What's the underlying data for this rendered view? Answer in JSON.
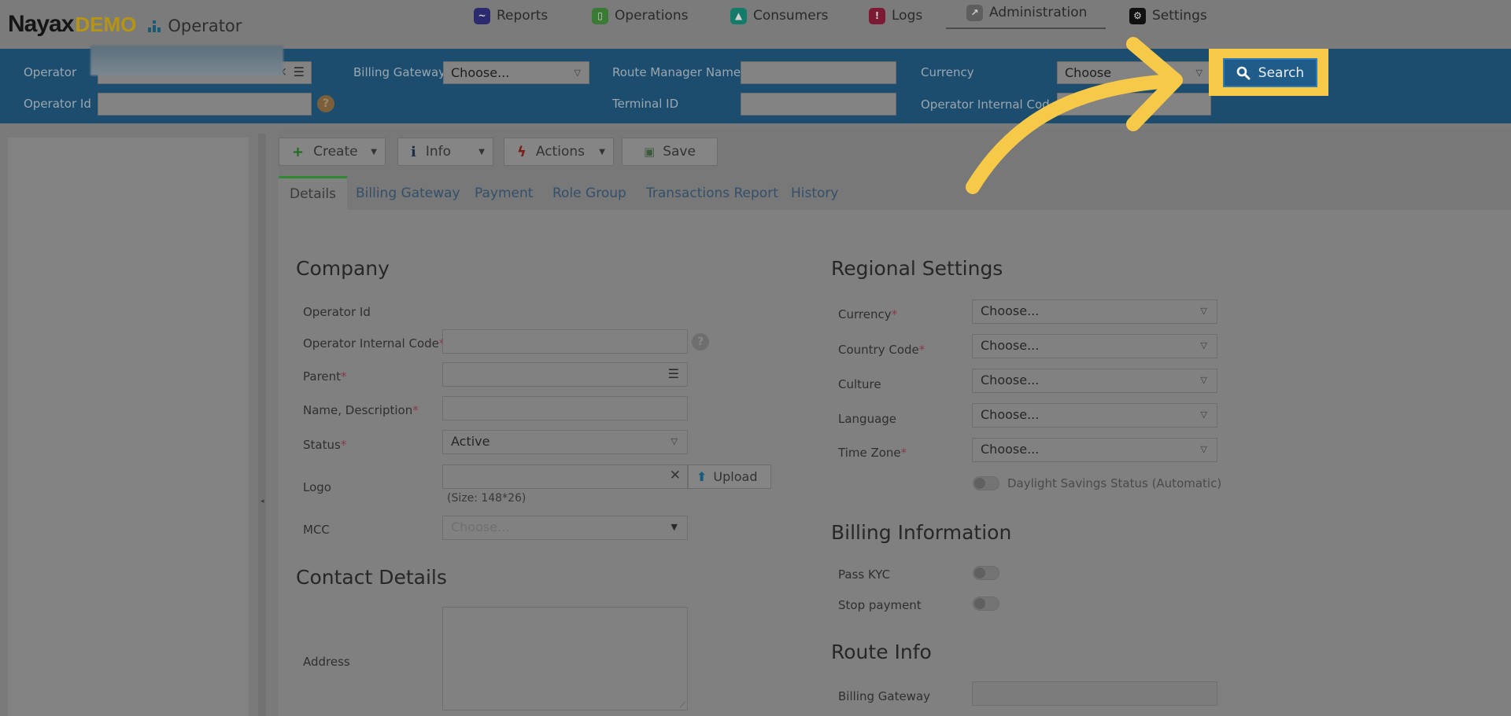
{
  "brand": {
    "name": "Nayax",
    "suffix": "DEMO",
    "section_label": "Operator"
  },
  "nav": [
    {
      "label": "Reports",
      "icon": "chart-line-icon",
      "color": "#2c2a6e"
    },
    {
      "label": "Operations",
      "icon": "clipboard-icon",
      "color": "#3a7a35"
    },
    {
      "label": "Consumers",
      "icon": "users-icon",
      "color": "#147a6a"
    },
    {
      "label": "Logs",
      "icon": "alert-icon",
      "color": "#7d1a33"
    },
    {
      "label": "Administration",
      "icon": "wrench-icon",
      "color": "#5e5e5e",
      "active": true
    },
    {
      "label": "Settings",
      "icon": "gear-icon",
      "color": "#111111"
    }
  ],
  "filters": {
    "operator_label": "Operator",
    "operator_id_label": "Operator Id",
    "billing_gateway_label": "Billing Gateway",
    "billing_gateway_value": "Choose...",
    "route_manager_label": "Route Manager Name",
    "terminal_id_label": "Terminal ID",
    "currency_label": "Currency",
    "currency_value": "Choose",
    "operator_internal_label": "Operator Internal Code",
    "search_label": "Search"
  },
  "toolbar": {
    "create": "Create",
    "info": "Info",
    "actions": "Actions",
    "save": "Save"
  },
  "tabs": [
    "Details",
    "Billing Gateway",
    "Payment",
    "Role Group",
    "Transactions Report",
    "History"
  ],
  "company": {
    "title": "Company",
    "operator_id": "Operator Id",
    "internal_code": "Operator Internal Code",
    "parent": "Parent",
    "name_desc": "Name, Description",
    "status": "Status",
    "status_value": "Active",
    "logo": "Logo",
    "upload": "Upload",
    "logo_size": "(Size: 148*26)",
    "mcc": "MCC",
    "mcc_placeholder": "Choose...",
    "required_mark": "*"
  },
  "contact": {
    "title": "Contact Details",
    "address": "Address"
  },
  "regional": {
    "title": "Regional Settings",
    "currency": "Currency",
    "country_code": "Country Code",
    "culture": "Culture",
    "language": "Language",
    "time_zone": "Time Zone",
    "choose": "Choose...",
    "dst": "Daylight Savings Status (Automatic)"
  },
  "billing": {
    "title": "Billing Information",
    "pass_kyc": "Pass KYC",
    "stop_payment": "Stop payment"
  },
  "route": {
    "title": "Route Info",
    "billing_gateway": "Billing Gateway"
  },
  "overlay": {
    "highlight_color": "#f7c948"
  }
}
